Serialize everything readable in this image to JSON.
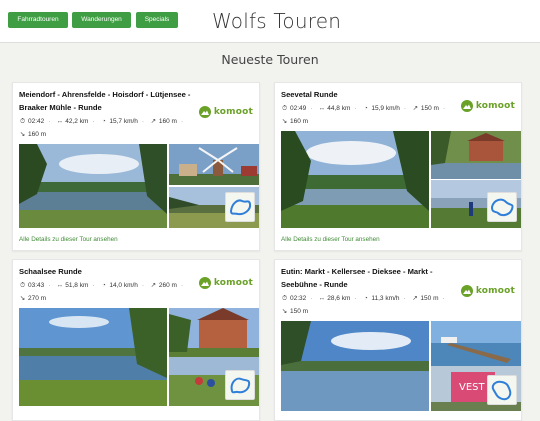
{
  "nav": {
    "buttons": [
      "Fahrradtouren",
      "Wanderungen",
      "Specials"
    ]
  },
  "site_title": "Wolfs Touren",
  "section_title": "Neueste Touren",
  "colors": {
    "accent_green": "#3f9e43",
    "komoot_green": "#6aa127",
    "link_green": "#3f8a36"
  },
  "brand": "komoot",
  "details_label": "Alle Details zu dieser Tour ansehen",
  "tours": [
    {
      "title": "Meiendorf - Ahrensfelde - Hoisdorf - Lütjensee - Braaker Mühle - Runde",
      "stats": {
        "duration": "02:42",
        "distance": "42,2 km",
        "speed": "15,7 km/h",
        "up": "160 m",
        "down": "160 m"
      }
    },
    {
      "title": "Seevetal Runde",
      "stats": {
        "duration": "02:49",
        "distance": "44,8 km",
        "speed": "15,9 km/h",
        "up": "150 m",
        "down": "160 m"
      }
    },
    {
      "title": "Schaalsee Runde",
      "stats": {
        "duration": "03:43",
        "distance": "51,8 km",
        "speed": "14,0 km/h",
        "up": "260 m",
        "down": "270 m"
      }
    },
    {
      "title": "Eutin: Markt - Kellersee - Dieksee - Markt - Seebühne - Runde",
      "stats": {
        "duration": "02:32",
        "distance": "28,6 km",
        "speed": "11,3 km/h",
        "up": "150 m",
        "down": "150 m"
      }
    }
  ],
  "icons": {
    "duration": "stopwatch-icon",
    "distance": "distance-arrows-icon",
    "speed": "speedometer-icon",
    "up": "uphill-arrow-icon",
    "down": "downhill-arrow-icon"
  }
}
